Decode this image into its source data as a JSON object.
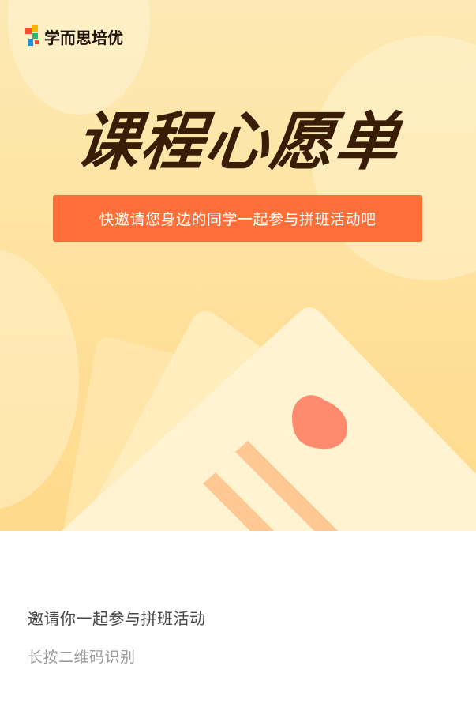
{
  "brand": {
    "name": "学而思培优",
    "logo_colors": [
      "#fd4e2b",
      "#ffb400",
      "#2bb673",
      "#1a8fe3"
    ]
  },
  "poster": {
    "headline": "课程心愿单",
    "banner": "快邀请您身边的同学一起参与拼班活动吧",
    "banner_color": "#fe6e38",
    "headline_color": "#3a1d07",
    "illustration": "envelope-heart-icon"
  },
  "footer": {
    "invite_text": "邀请你一起参与拼班活动",
    "qr_hint": "长按二维码识别"
  }
}
